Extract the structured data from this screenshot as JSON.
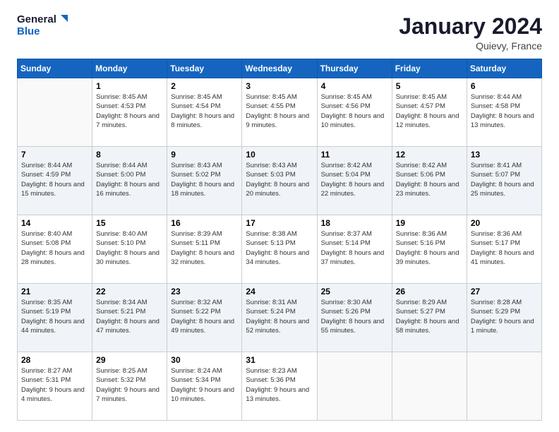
{
  "header": {
    "logo_line1": "General",
    "logo_line2": "Blue",
    "month_title": "January 2024",
    "location": "Quievy, France"
  },
  "weekdays": [
    "Sunday",
    "Monday",
    "Tuesday",
    "Wednesday",
    "Thursday",
    "Friday",
    "Saturday"
  ],
  "weeks": [
    [
      {
        "day": "",
        "sunrise": "",
        "sunset": "",
        "daylight": ""
      },
      {
        "day": "1",
        "sunrise": "Sunrise: 8:45 AM",
        "sunset": "Sunset: 4:53 PM",
        "daylight": "Daylight: 8 hours and 7 minutes."
      },
      {
        "day": "2",
        "sunrise": "Sunrise: 8:45 AM",
        "sunset": "Sunset: 4:54 PM",
        "daylight": "Daylight: 8 hours and 8 minutes."
      },
      {
        "day": "3",
        "sunrise": "Sunrise: 8:45 AM",
        "sunset": "Sunset: 4:55 PM",
        "daylight": "Daylight: 8 hours and 9 minutes."
      },
      {
        "day": "4",
        "sunrise": "Sunrise: 8:45 AM",
        "sunset": "Sunset: 4:56 PM",
        "daylight": "Daylight: 8 hours and 10 minutes."
      },
      {
        "day": "5",
        "sunrise": "Sunrise: 8:45 AM",
        "sunset": "Sunset: 4:57 PM",
        "daylight": "Daylight: 8 hours and 12 minutes."
      },
      {
        "day": "6",
        "sunrise": "Sunrise: 8:44 AM",
        "sunset": "Sunset: 4:58 PM",
        "daylight": "Daylight: 8 hours and 13 minutes."
      }
    ],
    [
      {
        "day": "7",
        "sunrise": "Sunrise: 8:44 AM",
        "sunset": "Sunset: 4:59 PM",
        "daylight": "Daylight: 8 hours and 15 minutes."
      },
      {
        "day": "8",
        "sunrise": "Sunrise: 8:44 AM",
        "sunset": "Sunset: 5:00 PM",
        "daylight": "Daylight: 8 hours and 16 minutes."
      },
      {
        "day": "9",
        "sunrise": "Sunrise: 8:43 AM",
        "sunset": "Sunset: 5:02 PM",
        "daylight": "Daylight: 8 hours and 18 minutes."
      },
      {
        "day": "10",
        "sunrise": "Sunrise: 8:43 AM",
        "sunset": "Sunset: 5:03 PM",
        "daylight": "Daylight: 8 hours and 20 minutes."
      },
      {
        "day": "11",
        "sunrise": "Sunrise: 8:42 AM",
        "sunset": "Sunset: 5:04 PM",
        "daylight": "Daylight: 8 hours and 22 minutes."
      },
      {
        "day": "12",
        "sunrise": "Sunrise: 8:42 AM",
        "sunset": "Sunset: 5:06 PM",
        "daylight": "Daylight: 8 hours and 23 minutes."
      },
      {
        "day": "13",
        "sunrise": "Sunrise: 8:41 AM",
        "sunset": "Sunset: 5:07 PM",
        "daylight": "Daylight: 8 hours and 25 minutes."
      }
    ],
    [
      {
        "day": "14",
        "sunrise": "Sunrise: 8:40 AM",
        "sunset": "Sunset: 5:08 PM",
        "daylight": "Daylight: 8 hours and 28 minutes."
      },
      {
        "day": "15",
        "sunrise": "Sunrise: 8:40 AM",
        "sunset": "Sunset: 5:10 PM",
        "daylight": "Daylight: 8 hours and 30 minutes."
      },
      {
        "day": "16",
        "sunrise": "Sunrise: 8:39 AM",
        "sunset": "Sunset: 5:11 PM",
        "daylight": "Daylight: 8 hours and 32 minutes."
      },
      {
        "day": "17",
        "sunrise": "Sunrise: 8:38 AM",
        "sunset": "Sunset: 5:13 PM",
        "daylight": "Daylight: 8 hours and 34 minutes."
      },
      {
        "day": "18",
        "sunrise": "Sunrise: 8:37 AM",
        "sunset": "Sunset: 5:14 PM",
        "daylight": "Daylight: 8 hours and 37 minutes."
      },
      {
        "day": "19",
        "sunrise": "Sunrise: 8:36 AM",
        "sunset": "Sunset: 5:16 PM",
        "daylight": "Daylight: 8 hours and 39 minutes."
      },
      {
        "day": "20",
        "sunrise": "Sunrise: 8:36 AM",
        "sunset": "Sunset: 5:17 PM",
        "daylight": "Daylight: 8 hours and 41 minutes."
      }
    ],
    [
      {
        "day": "21",
        "sunrise": "Sunrise: 8:35 AM",
        "sunset": "Sunset: 5:19 PM",
        "daylight": "Daylight: 8 hours and 44 minutes."
      },
      {
        "day": "22",
        "sunrise": "Sunrise: 8:34 AM",
        "sunset": "Sunset: 5:21 PM",
        "daylight": "Daylight: 8 hours and 47 minutes."
      },
      {
        "day": "23",
        "sunrise": "Sunrise: 8:32 AM",
        "sunset": "Sunset: 5:22 PM",
        "daylight": "Daylight: 8 hours and 49 minutes."
      },
      {
        "day": "24",
        "sunrise": "Sunrise: 8:31 AM",
        "sunset": "Sunset: 5:24 PM",
        "daylight": "Daylight: 8 hours and 52 minutes."
      },
      {
        "day": "25",
        "sunrise": "Sunrise: 8:30 AM",
        "sunset": "Sunset: 5:26 PM",
        "daylight": "Daylight: 8 hours and 55 minutes."
      },
      {
        "day": "26",
        "sunrise": "Sunrise: 8:29 AM",
        "sunset": "Sunset: 5:27 PM",
        "daylight": "Daylight: 8 hours and 58 minutes."
      },
      {
        "day": "27",
        "sunrise": "Sunrise: 8:28 AM",
        "sunset": "Sunset: 5:29 PM",
        "daylight": "Daylight: 9 hours and 1 minute."
      }
    ],
    [
      {
        "day": "28",
        "sunrise": "Sunrise: 8:27 AM",
        "sunset": "Sunset: 5:31 PM",
        "daylight": "Daylight: 9 hours and 4 minutes."
      },
      {
        "day": "29",
        "sunrise": "Sunrise: 8:25 AM",
        "sunset": "Sunset: 5:32 PM",
        "daylight": "Daylight: 9 hours and 7 minutes."
      },
      {
        "day": "30",
        "sunrise": "Sunrise: 8:24 AM",
        "sunset": "Sunset: 5:34 PM",
        "daylight": "Daylight: 9 hours and 10 minutes."
      },
      {
        "day": "31",
        "sunrise": "Sunrise: 8:23 AM",
        "sunset": "Sunset: 5:36 PM",
        "daylight": "Daylight: 9 hours and 13 minutes."
      },
      {
        "day": "",
        "sunrise": "",
        "sunset": "",
        "daylight": ""
      },
      {
        "day": "",
        "sunrise": "",
        "sunset": "",
        "daylight": ""
      },
      {
        "day": "",
        "sunrise": "",
        "sunset": "",
        "daylight": ""
      }
    ]
  ]
}
